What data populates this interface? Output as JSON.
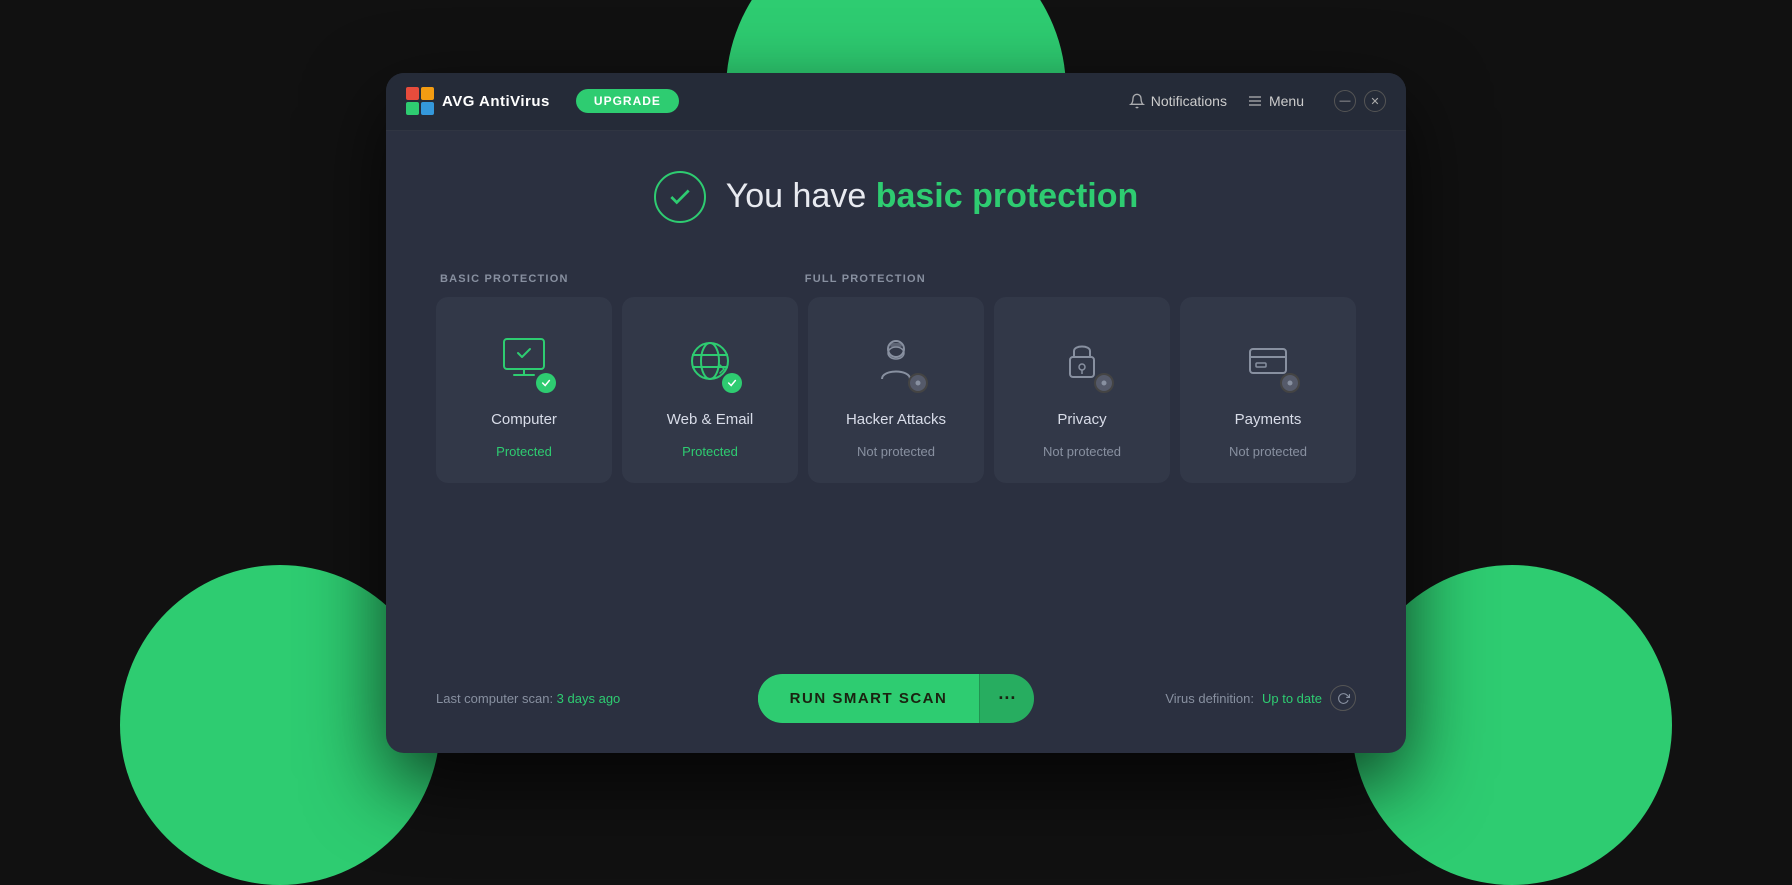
{
  "app": {
    "logo_text": "AVG  AntiVirus",
    "upgrade_label": "UPGRADE",
    "notifications_label": "Notifications",
    "menu_label": "Menu"
  },
  "status": {
    "prefix": "You have ",
    "highlight": "basic protection"
  },
  "sections": {
    "basic_label": "BASIC PROTECTION",
    "full_label": "FULL PROTECTION"
  },
  "cards": [
    {
      "id": "computer",
      "title": "Computer",
      "status_label": "Protected",
      "is_protected": true
    },
    {
      "id": "web-email",
      "title": "Web & Email",
      "status_label": "Protected",
      "is_protected": true
    },
    {
      "id": "hacker-attacks",
      "title": "Hacker Attacks",
      "status_label": "Not protected",
      "is_protected": false
    },
    {
      "id": "privacy",
      "title": "Privacy",
      "status_label": "Not protected",
      "is_protected": false
    },
    {
      "id": "payments",
      "title": "Payments",
      "status_label": "Not protected",
      "is_protected": false
    }
  ],
  "bottom": {
    "scan_prefix": "Last computer scan: ",
    "scan_time": "3 days ago",
    "scan_button": "RUN SMART SCAN",
    "more_button": "···",
    "virus_prefix": "Virus definition: ",
    "virus_status": "Up to date"
  }
}
